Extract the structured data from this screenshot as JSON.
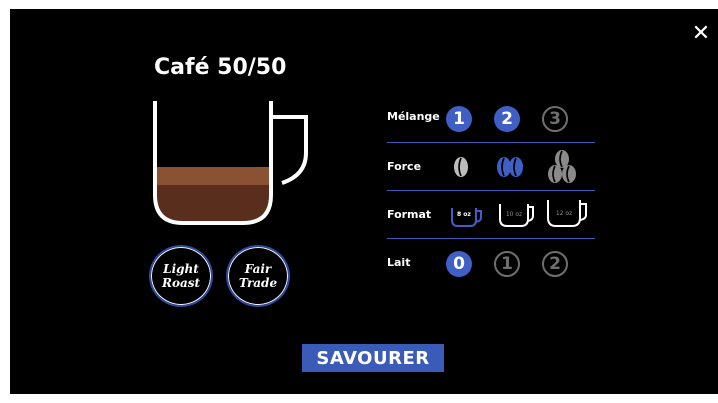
{
  "close_glyph": "✕",
  "drink": {
    "title": "Café 50/50",
    "badges": [
      "Light\nRoast",
      "Fair\nTrade"
    ]
  },
  "options": {
    "blend": {
      "label": "Mélange",
      "choices": [
        "1",
        "2",
        "3"
      ],
      "selected": [
        "1",
        "2"
      ]
    },
    "strength": {
      "label": "Force",
      "icons": [
        "single-bean-icon",
        "two-beans-icon",
        "three-beans-icon"
      ],
      "selected_index": 1
    },
    "format": {
      "label": "Format",
      "sizes": [
        "8 oz",
        "10 oz",
        "12 oz"
      ],
      "selected": "8 oz"
    },
    "milk": {
      "label": "Lait",
      "choices": [
        "0",
        "1",
        "2"
      ],
      "selected": "0"
    }
  },
  "cta": {
    "label": "SAVOURER"
  },
  "colors": {
    "accent": "#3f5fc4",
    "coffee_dark": "#5a2e1c",
    "coffee_light": "#8a5233",
    "inactive": "#6f6f6f"
  }
}
